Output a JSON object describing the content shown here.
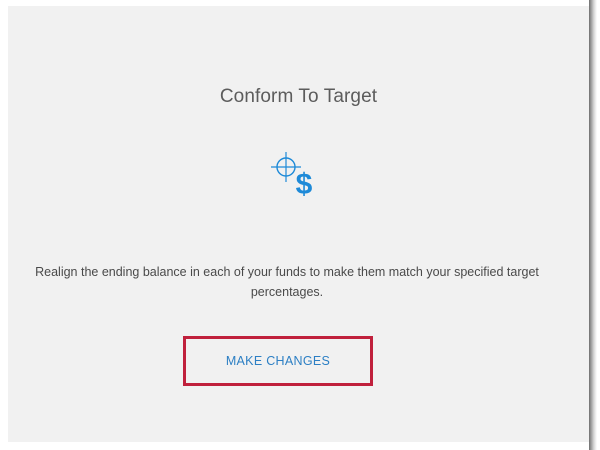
{
  "card": {
    "title": "Conform To Target",
    "icon": "target-dollar-icon",
    "description": "Realign the ending balance in each of your funds to make them match your specified target percentages.",
    "button_label": "MAKE CHANGES"
  },
  "colors": {
    "card_background": "#f1f1f1",
    "icon_blue": "#1e8ad8",
    "button_text": "#2c7fc4",
    "highlight_border": "#c0203c",
    "title_text": "#5c5c5c"
  }
}
